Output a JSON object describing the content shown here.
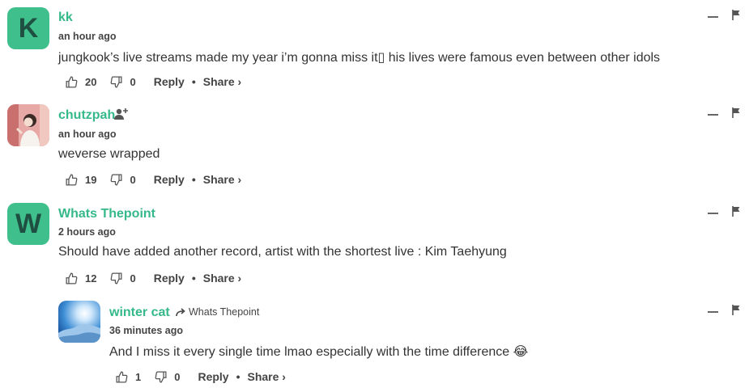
{
  "comments": [
    {
      "avatar_letter": "K",
      "username": "kk",
      "timestamp": "an hour ago",
      "text": "jungkook’s live streams made my year i’m gonna miss it▯ his lives were famous even between other idols",
      "likes": "20",
      "dislikes": "0",
      "reply_label": "Reply",
      "share_label": "Share ›"
    },
    {
      "username": "chutzpah",
      "timestamp": "an hour ago",
      "text": "weverse wrapped",
      "likes": "19",
      "dislikes": "0",
      "reply_label": "Reply",
      "share_label": "Share ›"
    },
    {
      "avatar_letter": "W",
      "username": "Whats Thepoint",
      "timestamp": "2 hours ago",
      "text": "Should have added another record, artist with the shortest live : Kim Taehyung",
      "likes": "12",
      "dislikes": "0",
      "reply_label": "Reply",
      "share_label": "Share ›"
    },
    {
      "username": "winter cat",
      "reply_to": "Whats Thepoint",
      "timestamp": "36 minutes ago",
      "text": "And I miss it every single time lmao especially with the time difference",
      "emoji": "😂",
      "likes": "1",
      "dislikes": "0",
      "reply_label": "Reply",
      "share_label": "Share ›"
    }
  ],
  "icons": {
    "like": "thumbs-up-icon",
    "dislike": "thumbs-down-icon",
    "minimize": "minimize-icon",
    "flag": "flag-icon",
    "follow": "add-user-icon",
    "reply_arrow": "reply-arrow-icon"
  },
  "colors": {
    "accent": "#35b98a",
    "avatar_bg": "#3fbf8c",
    "avatar_letter": "#1e4f41"
  }
}
